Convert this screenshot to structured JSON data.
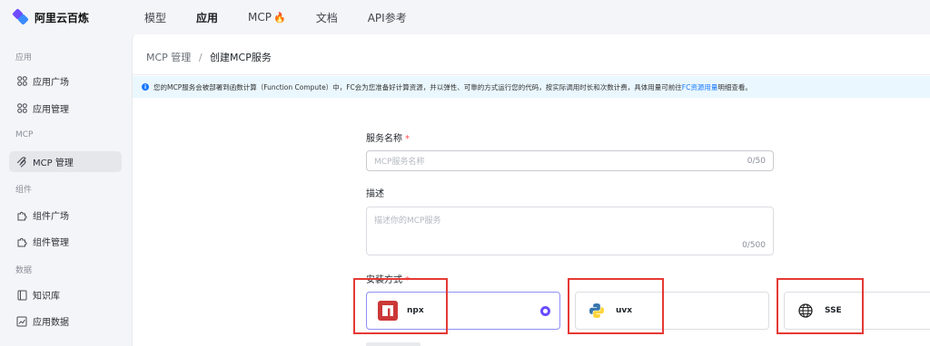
{
  "brand": {
    "name": "阿里云百炼"
  },
  "nav": {
    "items": [
      "模型",
      "应用",
      "MCP",
      "文档",
      "API参考"
    ],
    "active": 1
  },
  "sidebar": {
    "groups": [
      {
        "title": "应用",
        "items": [
          {
            "label": "应用广场",
            "icon": "grid-icon"
          },
          {
            "label": "应用管理",
            "icon": "grid-icon"
          }
        ]
      },
      {
        "title": "MCP",
        "items": [
          {
            "label": "MCP 管理",
            "icon": "mcp-icon",
            "active": true
          }
        ]
      },
      {
        "title": "组件",
        "items": [
          {
            "label": "组件广场",
            "icon": "puzzle-icon"
          },
          {
            "label": "组件管理",
            "icon": "puzzle-icon"
          }
        ]
      },
      {
        "title": "数据",
        "items": [
          {
            "label": "知识库",
            "icon": "book-icon"
          },
          {
            "label": "应用数据",
            "icon": "chart-icon"
          }
        ]
      }
    ]
  },
  "breadcrumb": {
    "parent": "MCP 管理",
    "separator": "/",
    "current": "创建MCP服务"
  },
  "info": {
    "text": "您的MCP服务会被部署到函数计算（Function Compute）中，FC会为您准备好计算资源，并以弹性、可靠的方式运行您的代码，按实际调用时长和次数计费，具体用量可前往",
    "link": "FC资源用量",
    "suffix": "明细查看。"
  },
  "form": {
    "name_label": "服务名称",
    "name_placeholder": "MCP服务名称",
    "name_counter": "0/50",
    "desc_label": "描述",
    "desc_placeholder": "描述你的MCP服务",
    "desc_counter": "0/500",
    "install_label": "安装方式",
    "required_mark": "*",
    "options": [
      {
        "label": "npx",
        "icon": "npm-icon",
        "selected": true
      },
      {
        "label": "uvx",
        "icon": "python-icon",
        "selected": false
      },
      {
        "label": "SSE",
        "icon": "globe-icon",
        "selected": false
      }
    ]
  },
  "colors": {
    "accent": "#6a4cff",
    "highlight": "#e53935",
    "info_bg": "#eaf7fe",
    "link": "#1677ff"
  }
}
